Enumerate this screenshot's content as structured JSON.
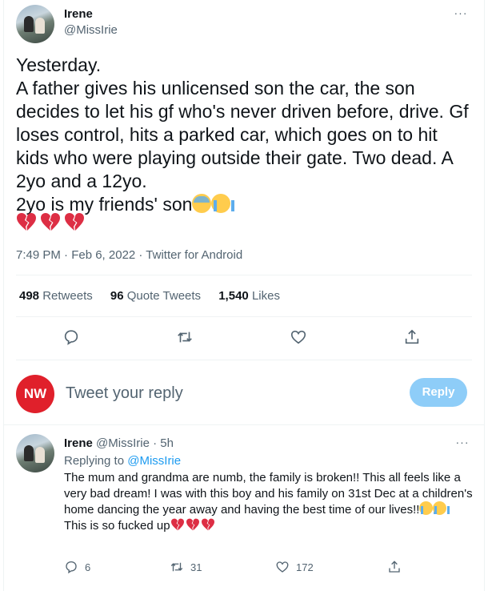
{
  "main_tweet": {
    "author_name": "Irene",
    "author_handle": "@MissIrie",
    "text": "Yesterday.\nA father gives his unlicensed son the car, the son decides to let his gf who's never driven before, drive. Gf loses control, hits a parked car, which goes on to hit kids who were playing outside their gate. Two dead. A 2yo and a 12yo.\n2yo is my friends' son",
    "emojis_after_text": [
      "downcast-face-with-sweat",
      "loudly-crying-face"
    ],
    "broken_hearts_count": 3,
    "timestamp": "7:49 PM · Feb 6, 2022 · Twitter for Android",
    "more_label": "···"
  },
  "stats": {
    "retweets_count": "498",
    "retweets_label": "Retweets",
    "quotes_count": "96",
    "quotes_label": "Quote Tweets",
    "likes_count": "1,540",
    "likes_label": "Likes"
  },
  "actions": [
    "reply-icon",
    "retweet-icon",
    "like-icon",
    "share-icon"
  ],
  "composer": {
    "avatar_text": "NW",
    "placeholder": "Tweet your reply",
    "button_label": "Reply"
  },
  "reply": {
    "author_name": "Irene",
    "author_handle": "@MissIrie",
    "time": "· 5h",
    "replying_to_prefix": "Replying to",
    "replying_to_handle": "@MissIrie",
    "text_part1": "The mum and grandma are numb, the family is broken!! This all feels like a very bad dream! I was with this boy and his family on 31st Dec at a children's home dancing the year away and having the best time of our lives!!",
    "text_part2": "This is so fucked up",
    "reply_count": "6",
    "retweet_count": "31",
    "like_count": "172",
    "more_label": "···"
  },
  "colors": {
    "accent": "#1d9bf0",
    "reply_button_disabled": "#8ecdf8",
    "nw_red": "#e0202b",
    "broken_heart": "#dd2e44",
    "muted_text": "#536471"
  }
}
